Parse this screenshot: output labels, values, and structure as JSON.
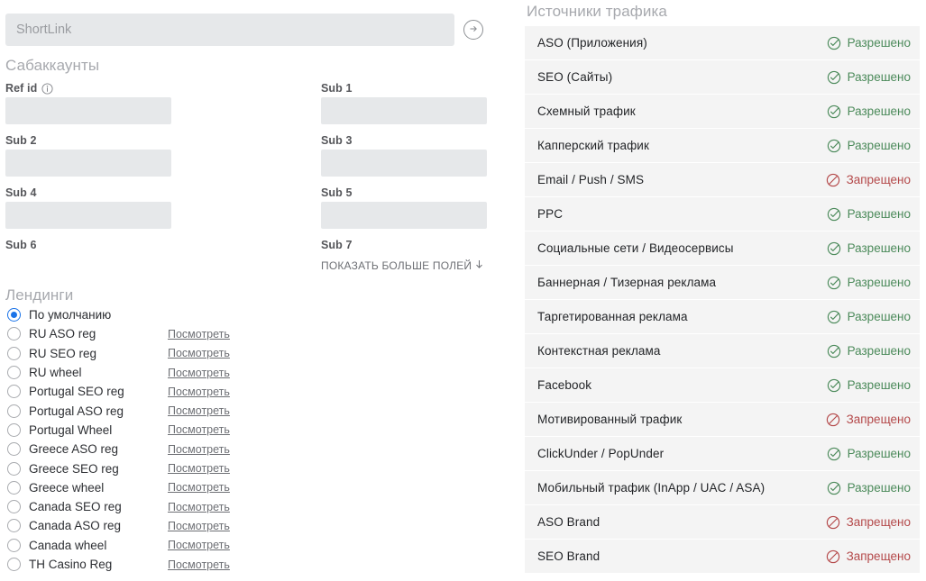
{
  "shortlink": {
    "placeholder": "ShortLink",
    "value": "",
    "submit_icon": "arrow-right-circle-icon"
  },
  "subaccounts": {
    "heading": "Сабаккаунты",
    "fields": [
      {
        "label": "Ref id",
        "value": "",
        "has_info_icon": true
      },
      {
        "label": "Sub 1",
        "value": "",
        "has_info_icon": false
      },
      {
        "label": "Sub 2",
        "value": "",
        "has_info_icon": false
      },
      {
        "label": "Sub 3",
        "value": "",
        "has_info_icon": false
      },
      {
        "label": "Sub 4",
        "value": "",
        "has_info_icon": false
      },
      {
        "label": "Sub 5",
        "value": "",
        "has_info_icon": false
      },
      {
        "label": "Sub 6",
        "value": "",
        "has_info_icon": false
      },
      {
        "label": "Sub 7",
        "value": "",
        "has_info_icon": false
      }
    ],
    "show_more_label": "ПОКАЗАТЬ БОЛЬШЕ ПОЛЕЙ",
    "show_more_icon": "arrow-down-icon"
  },
  "landings": {
    "heading": "Лендинги",
    "view_link_label": "Посмотреть",
    "selected_index": 0,
    "items": [
      {
        "label": "По умолчанию",
        "selected": true,
        "has_link": false
      },
      {
        "label": "RU ASO reg",
        "selected": false,
        "has_link": true
      },
      {
        "label": "RU SEO reg",
        "selected": false,
        "has_link": true
      },
      {
        "label": "RU wheel",
        "selected": false,
        "has_link": true
      },
      {
        "label": "Portugal SEO reg",
        "selected": false,
        "has_link": true
      },
      {
        "label": "Portugal ASO reg",
        "selected": false,
        "has_link": true
      },
      {
        "label": "Portugal Wheel",
        "selected": false,
        "has_link": true
      },
      {
        "label": "Greece ASO reg",
        "selected": false,
        "has_link": true
      },
      {
        "label": "Greece SEO reg",
        "selected": false,
        "has_link": true
      },
      {
        "label": "Greece wheel",
        "selected": false,
        "has_link": true
      },
      {
        "label": "Canada SEO reg",
        "selected": false,
        "has_link": true
      },
      {
        "label": "Canada ASO reg",
        "selected": false,
        "has_link": true
      },
      {
        "label": "Canada wheel",
        "selected": false,
        "has_link": true
      },
      {
        "label": "TH Casino Reg",
        "selected": false,
        "has_link": true
      }
    ]
  },
  "traffic_sources": {
    "heading": "Источники трафика",
    "status_labels": {
      "allowed": "Разрешено",
      "denied": "Запрещено"
    },
    "status_icons": {
      "allowed": "check-circle-icon",
      "denied": "forbidden-icon"
    },
    "rows": [
      {
        "name": "ASO (Приложения)",
        "status": "allowed",
        "status_label": "Разрешено"
      },
      {
        "name": "SEO (Сайты)",
        "status": "allowed",
        "status_label": "Разрешено"
      },
      {
        "name": "Схемный трафик",
        "status": "allowed",
        "status_label": "Разрешено"
      },
      {
        "name": "Капперский трафик",
        "status": "allowed",
        "status_label": "Разрешено"
      },
      {
        "name": "Email / Push / SMS",
        "status": "denied",
        "status_label": "Запрещено"
      },
      {
        "name": "PPC",
        "status": "allowed",
        "status_label": "Разрешено"
      },
      {
        "name": "Социальные сети / Видеосервисы",
        "status": "allowed",
        "status_label": "Разрешено"
      },
      {
        "name": "Баннерная / Тизерная реклама",
        "status": "allowed",
        "status_label": "Разрешено"
      },
      {
        "name": "Таргетированная реклама",
        "status": "allowed",
        "status_label": "Разрешено"
      },
      {
        "name": "Контекстная реклама",
        "status": "allowed",
        "status_label": "Разрешено"
      },
      {
        "name": "Facebook",
        "status": "allowed",
        "status_label": "Разрешено"
      },
      {
        "name": "Мотивированный трафик",
        "status": "denied",
        "status_label": "Запрещено"
      },
      {
        "name": "ClickUnder / PopUnder",
        "status": "allowed",
        "status_label": "Разрешено"
      },
      {
        "name": "Мобильный трафик (InApp / UAC / ASA)",
        "status": "allowed",
        "status_label": "Разрешено"
      },
      {
        "name": "ASO Brand",
        "status": "denied",
        "status_label": "Запрещено"
      },
      {
        "name": "SEO Brand",
        "status": "denied",
        "status_label": "Запрещено"
      }
    ]
  },
  "colors": {
    "allowed": "#4b8a5a",
    "denied": "#b4494a",
    "accent": "#1a73e8",
    "field_bg": "#e6e8ea",
    "row_bg": "#f4f4f4"
  }
}
